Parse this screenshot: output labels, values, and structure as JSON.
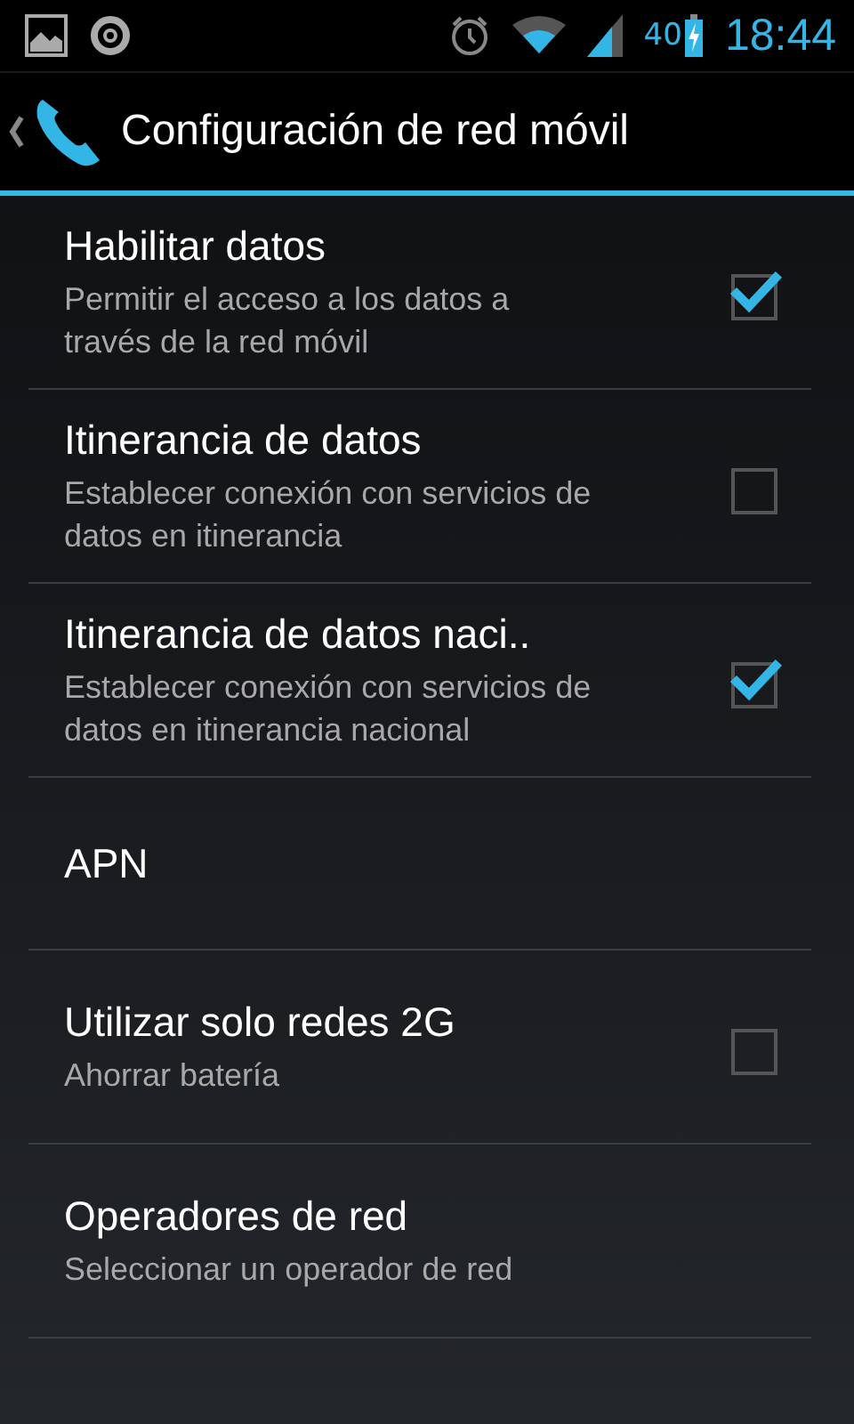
{
  "status_bar": {
    "battery": "40",
    "time": "18:44"
  },
  "action_bar": {
    "title": "Configuración de red móvil"
  },
  "settings": [
    {
      "kind": "checkbox",
      "title": "Habilitar datos",
      "summary": "Permitir el acceso a los datos a través de la red móvil",
      "checked": true
    },
    {
      "kind": "checkbox",
      "title": "Itinerancia de datos",
      "summary": "Establecer conexión con servicios de datos en itinerancia",
      "checked": false
    },
    {
      "kind": "checkbox",
      "title": "Itinerancia de datos naci..",
      "summary": "Establecer conexión con servicios de datos en itinerancia nacional",
      "checked": true
    },
    {
      "kind": "plain",
      "title": "APN"
    },
    {
      "kind": "checkbox",
      "title": "Utilizar solo redes 2G",
      "summary": "Ahorrar batería",
      "checked": false
    },
    {
      "kind": "plain",
      "title": "Operadores de red",
      "summary": "Seleccionar un operador de red"
    }
  ]
}
